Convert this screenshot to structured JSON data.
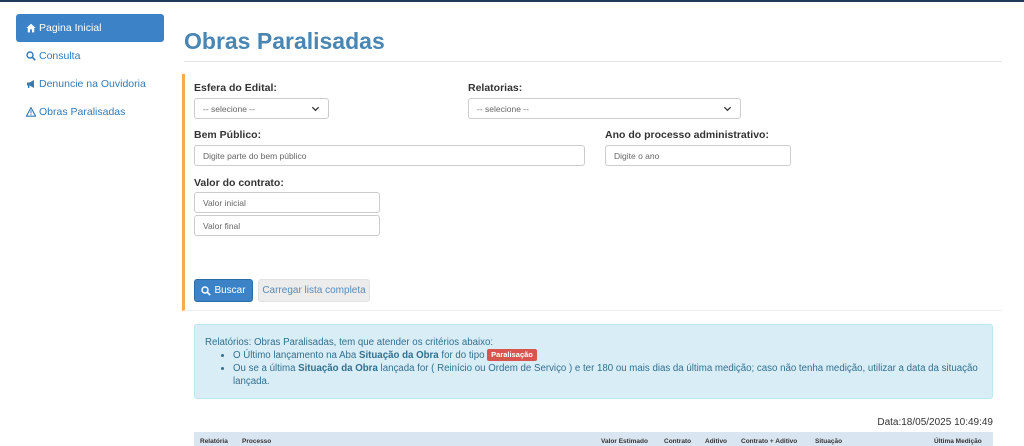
{
  "sidebar": {
    "items": [
      {
        "label": "Pagina Inicial",
        "icon": "home-icon",
        "active": true
      },
      {
        "label": "Consulta",
        "icon": "search-icon"
      },
      {
        "label": "Denuncie na Ouvidoria",
        "icon": "megaphone-icon"
      },
      {
        "label": "Obras Paralisadas",
        "icon": "warning-icon"
      }
    ]
  },
  "page": {
    "title": "Obras Paralisadas"
  },
  "form": {
    "esfera_label": "Esfera do Edital:",
    "esfera_value": "-- selecione --",
    "relatorias_label": "Relatorias:",
    "relatorias_value": "-- selecione --",
    "bem_label": "Bem Público:",
    "bem_placeholder": "Digite parte do bem público",
    "ano_label": "Ano do processo administrativo:",
    "ano_placeholder": "Digite o ano",
    "valor_label": "Valor do contrato:",
    "valor_inicial_placeholder": "Valor inicial",
    "valor_final_placeholder": "Valor final",
    "buscar_label": "Buscar",
    "carregar_label": "Carregar lista completa"
  },
  "info": {
    "intro": "Relatórios: Obras Paralisadas, tem que atender os critérios abaixo:",
    "b1_pre": "O Último lançamento na Aba ",
    "b1_bold": "Situação da Obra",
    "b1_post": " for do tipo ",
    "b1_badge": "Paralisação",
    "b2_pre": "Ou se a última ",
    "b2_bold": "Situação da Obra",
    "b2_post": " lançada for ( Reinício ou Ordem de Serviço ) e ter 180 ou mais dias da última medição; caso não tenha medição, utilizar a data da situação lançada."
  },
  "date_line": "Data:18/05/2025 10:49:49",
  "table": {
    "columns": [
      "Relatória",
      "Processo",
      "Valor Estimado",
      "Contrato",
      "Aditivo",
      "Contrato + Aditivo",
      "Situação",
      "Última Medição"
    ]
  },
  "colors": {
    "accent": "#3b83c6",
    "title": "#4a86b4",
    "panel_border": "#f0ad4e",
    "info_bg": "#d9edf7",
    "badge": "#d9534f"
  }
}
